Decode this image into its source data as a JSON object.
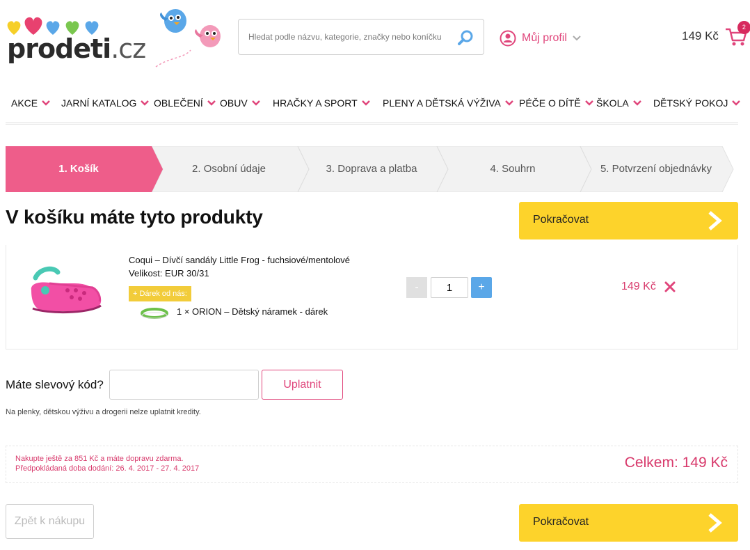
{
  "header": {
    "logo_text": "prodeti",
    "logo_suffix": ".cz",
    "search_placeholder": "Hledat podle názvu, kategorie, značky nebo koníčku",
    "profile_label": "Můj profil",
    "cart_total": "149 Kč",
    "cart_count": "2"
  },
  "nav": {
    "items": [
      "AKCE",
      "JARNÍ KATALOG",
      "OBLEČENÍ",
      "OBUV",
      "HRAČKY A SPORT",
      "PLENY A DĚTSKÁ VÝŽIVA",
      "PÉČE O DÍTĚ",
      "ŠKOLA",
      "DĚTSKÝ POKOJ"
    ]
  },
  "steps": [
    "1. Košík",
    "2. Osobní údaje",
    "3. Doprava a platba",
    "4. Souhrn",
    "5. Potvrzení objednávky"
  ],
  "cart": {
    "title": "V košíku máte tyto produkty",
    "continue_label": "Pokračovat",
    "product": {
      "name": "Coqui – Dívčí sandály Little Frog - fuchsiové/mentolové",
      "size": "Velikost: EUR 30/31",
      "gift_badge": "+ Dárek od nás:",
      "gift_name": "1 × ORION – Dětský náramek - dárek",
      "quantity": "1",
      "minus": "-",
      "plus": "+",
      "price": "149 Kč"
    }
  },
  "discount": {
    "label": "Máte slevový kód?",
    "button": "Uplatnit",
    "note": "Na plenky, dětskou výživu a drogerii nelze uplatnit kredity."
  },
  "summary": {
    "free_shipping": "Nakupte ještě za 851 Kč a máte dopravu zdarma.",
    "delivery": "Předpokládaná doba dodání: 26. 4. 2017 - 27. 4. 2017",
    "total": "Celkem: 149 Kč"
  },
  "footer_buttons": {
    "back": "Zpět k nákupu",
    "continue": "Pokračovat"
  },
  "colors": {
    "accent_pink": "#e0457b",
    "step_active": "#ee5d8a",
    "button_yellow": "#fdd32b",
    "plus_blue": "#5aa7e8"
  }
}
